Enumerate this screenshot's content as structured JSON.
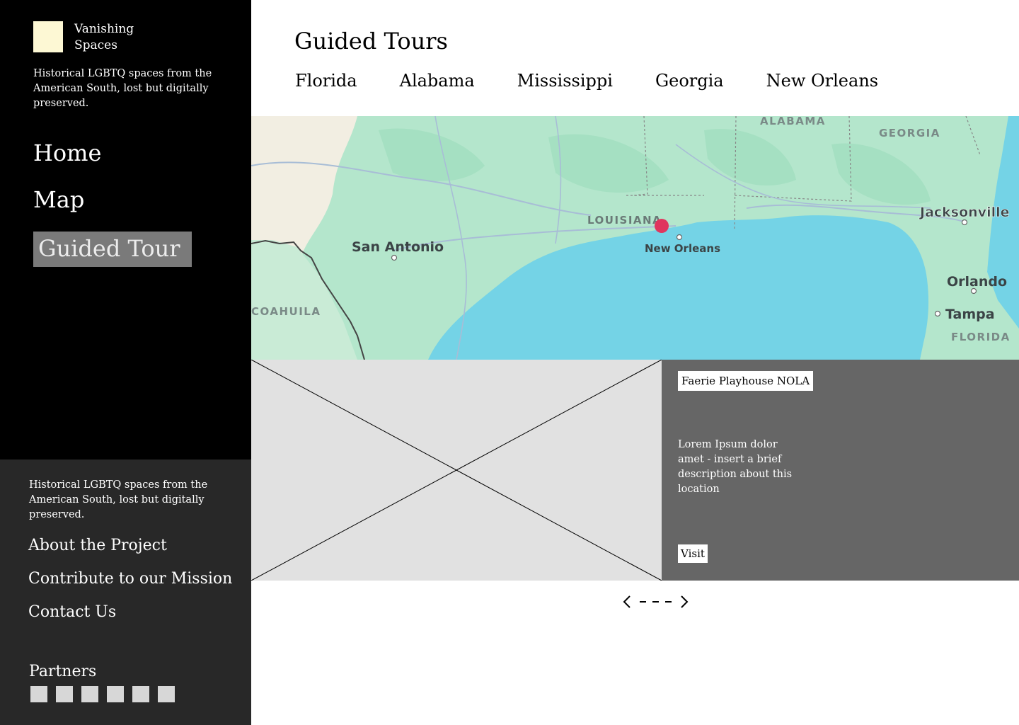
{
  "brand": {
    "name": "Vanishing Spaces",
    "logo_color": "#fdf8d4"
  },
  "sidebar": {
    "tagline": "Historical LGBTQ spaces from the American South, lost but digitally preserved.",
    "nav": [
      {
        "label": "Home"
      },
      {
        "label": "Map"
      },
      {
        "label": "Guided Tour",
        "active": true
      }
    ]
  },
  "footer": {
    "tagline": "Historical LGBTQ spaces from the American South, lost but digitally preserved.",
    "links": [
      {
        "label": "About the Project"
      },
      {
        "label": "Contribute to our Mission"
      },
      {
        "label": "Contact Us"
      }
    ],
    "partners_title": "Partners",
    "partner_count": 6
  },
  "header": {
    "title": "Guided Tours",
    "states": [
      "Florida",
      "Alabama",
      "Mississippi",
      "Georgia",
      "New Orleans"
    ]
  },
  "map": {
    "labels": {
      "alabama": "ALABAMA",
      "georgia": "GEORGIA",
      "louisiana": "LOUISIANA",
      "jacksonville": "Jacksonville",
      "san_antonio": "San Antonio",
      "new_orleans": "New Orleans",
      "orlando": "Orlando",
      "coahuila": "COAHUILA",
      "tampa": "Tampa",
      "florida": "FLORIDA"
    },
    "marker_color": "#e0365e",
    "water_color": "#74d3e6",
    "land_color": "#b4e6cc"
  },
  "location": {
    "name": "Faerie Playhouse NOLA",
    "description": "Lorem Ipsum dolor amet - insert a brief description about this location",
    "visit_label": "Visit"
  },
  "pager": {
    "dots": 3
  }
}
